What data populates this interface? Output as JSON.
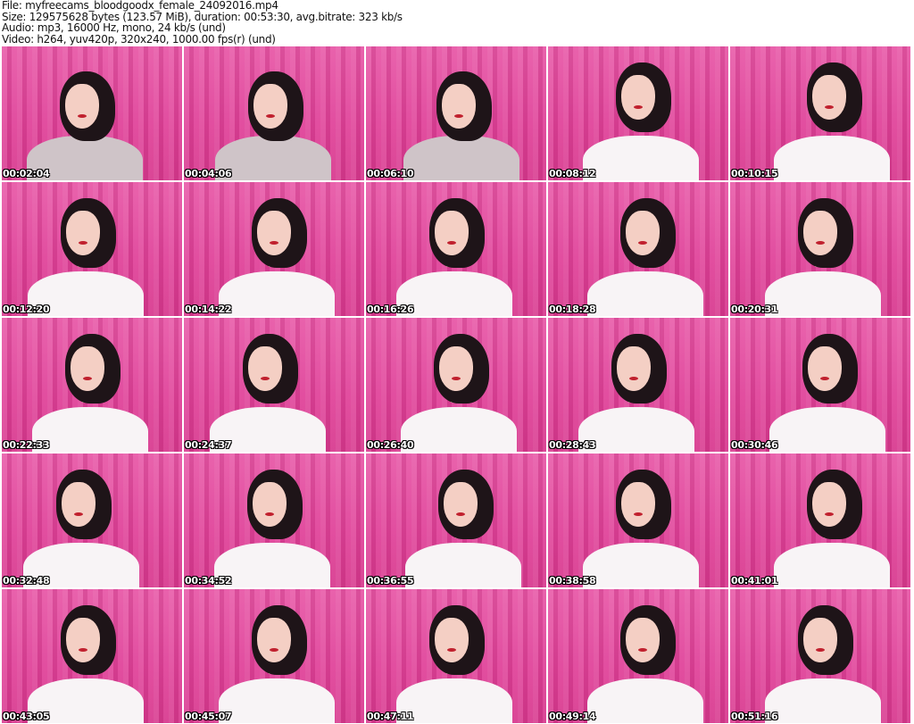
{
  "header": {
    "file": "File: myfreecams_bloodgoodx_female_24092016.mp4",
    "size": "Size: 129575628 bytes (123.57 MiB), duration: 00:53:30, avg.bitrate: 323 kb/s",
    "audio": "Audio: mp3, 16000 Hz, mono, 24 kb/s (und)",
    "video": "Video: h264, yuv420p, 320x240, 1000.00 fps(r) (und)"
  },
  "thumbnails": [
    {
      "time": "00:02:04"
    },
    {
      "time": "00:04:06"
    },
    {
      "time": "00:06:10"
    },
    {
      "time": "00:08:12"
    },
    {
      "time": "00:10:15"
    },
    {
      "time": "00:12:20"
    },
    {
      "time": "00:14:22"
    },
    {
      "time": "00:16:26"
    },
    {
      "time": "00:18:28"
    },
    {
      "time": "00:20:31"
    },
    {
      "time": "00:22:33"
    },
    {
      "time": "00:24:37"
    },
    {
      "time": "00:26:40"
    },
    {
      "time": "00:28:43"
    },
    {
      "time": "00:30:46"
    },
    {
      "time": "00:32:48"
    },
    {
      "time": "00:34:52"
    },
    {
      "time": "00:36:55"
    },
    {
      "time": "00:38:58"
    },
    {
      "time": "00:41:01"
    },
    {
      "time": "00:43:05"
    },
    {
      "time": "00:45:07"
    },
    {
      "time": "00:47:11"
    },
    {
      "time": "00:49:14"
    },
    {
      "time": "00:51:16"
    }
  ]
}
